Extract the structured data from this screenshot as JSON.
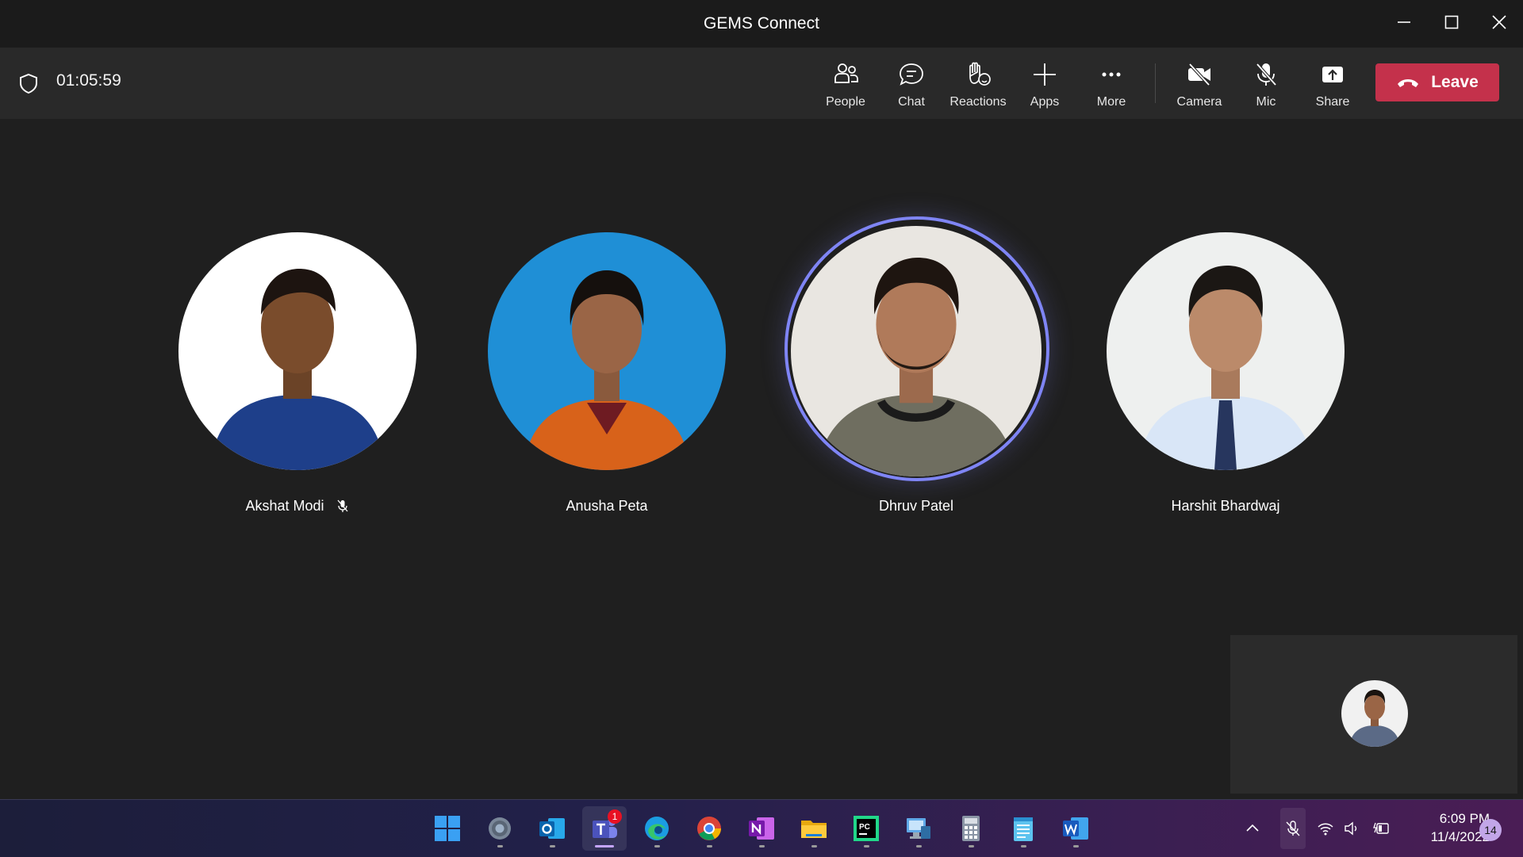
{
  "window": {
    "title": "GEMS Connect",
    "controls": [
      "minimize-icon",
      "maximize-icon",
      "close-icon"
    ]
  },
  "meeting": {
    "elapsed": "01:05:59",
    "toolbar": {
      "people": "People",
      "chat": "Chat",
      "reactions": "Reactions",
      "apps": "Apps",
      "more": "More",
      "camera": "Camera",
      "mic": "Mic",
      "share": "Share",
      "leave": "Leave"
    },
    "participants": [
      {
        "name": "Akshat Modi",
        "muted": true,
        "speaking": false,
        "photo_bg": "#ffffff",
        "shirt": "#1e3f8a"
      },
      {
        "name": "Anusha Peta",
        "muted": false,
        "speaking": false,
        "photo_bg": "#1f8fd6",
        "shirt": "#d8621a"
      },
      {
        "name": "Dhruv Patel",
        "muted": false,
        "speaking": true,
        "photo_bg": "#e9e6e1",
        "shirt": "#6f6e60"
      },
      {
        "name": "Harshit Bhardwaj",
        "muted": false,
        "speaking": false,
        "photo_bg": "#eef0ef",
        "shirt": "#d9e6f7"
      }
    ],
    "self_view": {
      "photo_bg": "#f1f1f1",
      "shirt": "#5b6a86"
    }
  },
  "colors": {
    "accent": "#7f85f5",
    "leave_red": "#c4314b",
    "background": "#1f1f1f"
  },
  "taskbar": {
    "apps": [
      {
        "name": "start-icon"
      },
      {
        "name": "settings-icon"
      },
      {
        "name": "outlook-icon"
      },
      {
        "name": "teams-icon",
        "badge": "1",
        "active": true
      },
      {
        "name": "edge-icon"
      },
      {
        "name": "chrome-icon"
      },
      {
        "name": "onenote-icon"
      },
      {
        "name": "file-explorer-icon"
      },
      {
        "name": "pycharm-icon"
      },
      {
        "name": "remote-desktop-icon"
      },
      {
        "name": "calculator-icon"
      },
      {
        "name": "notepad-icon"
      },
      {
        "name": "word-icon"
      }
    ],
    "clock_time": "6:09 PM",
    "clock_date": "11/4/2022",
    "notification_count": "14"
  }
}
